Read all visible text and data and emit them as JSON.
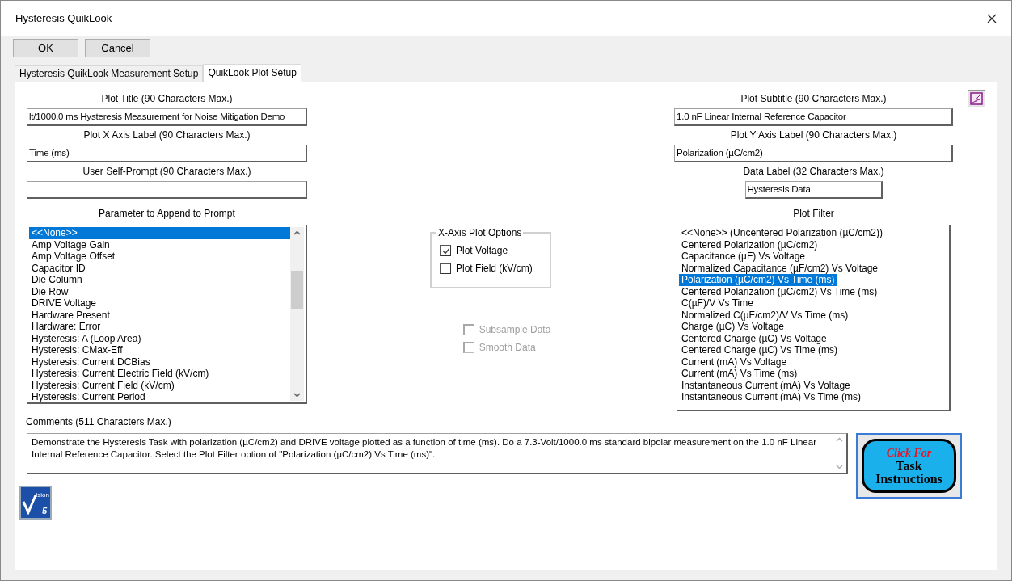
{
  "window": {
    "title": "Hysteresis QuikLook"
  },
  "buttons": [
    "OK",
    "Cancel"
  ],
  "tabs": [
    {
      "label": "Hysteresis QuikLook Measurement Setup",
      "selected": false
    },
    {
      "label": "QuikLook Plot Setup",
      "selected": true
    }
  ],
  "left_fields": [
    {
      "label": "Plot Title (90 Characters Max.)",
      "value": "lt/1000.0 ms Hysteresis Measurement for Noise Mitigation Demo"
    },
    {
      "label": "Plot X Axis Label (90 Characters Max.)",
      "value": "Time (ms)"
    },
    {
      "label": "User Self-Prompt (90 Characters Max.)"
    }
  ],
  "right_fields": [
    {
      "label": "Plot Subtitle (90 Characters Max.)",
      "value": "1.0 nF Linear Internal Reference Capacitor"
    },
    {
      "label": "Plot Y Axis Label (90 Characters Max.)",
      "value": "Polarization (µC/cm2)"
    },
    {
      "label": "Data Label (32 Characters Max.)",
      "value": "Hysteresis Data",
      "kind": "short"
    }
  ],
  "parameter_list": {
    "label": "Parameter to Append to Prompt",
    "items": [
      {
        "text": "<<None>>",
        "selected": true
      },
      {
        "text": "Amp Voltage Gain",
        "selected": false
      },
      {
        "text": "Amp Voltage Offset",
        "selected": false
      },
      {
        "text": "Capacitor ID",
        "selected": false
      },
      {
        "text": "Die Column",
        "selected": false
      },
      {
        "text": "Die Row",
        "selected": false
      },
      {
        "text": "DRIVE Voltage",
        "selected": false
      },
      {
        "text": "Hardware Present",
        "selected": false
      },
      {
        "text": "Hardware: Error",
        "selected": false
      },
      {
        "text": "Hysteresis: A (Loop Area)",
        "selected": false
      },
      {
        "text": "Hysteresis: CMax-Eff",
        "selected": false
      },
      {
        "text": "Hysteresis: Current DCBias",
        "selected": false
      },
      {
        "text": "Hysteresis: Current Electric Field (kV/cm)",
        "selected": false
      },
      {
        "text": "Hysteresis: Current Field (kV/cm)",
        "selected": false
      },
      {
        "text": "Hysteresis: Current Period",
        "selected": false
      }
    ]
  },
  "x_axis_options": {
    "title": "X-Axis Plot Options",
    "options": [
      {
        "label": "Plot Voltage",
        "checked": true
      },
      {
        "label": "Plot Field (kV/cm)",
        "checked": false
      }
    ]
  },
  "data_options": [
    {
      "label": "Subsample Data",
      "checked": false,
      "disabled": true
    },
    {
      "label": "Smooth Data",
      "checked": false,
      "disabled": true
    }
  ],
  "plot_filter": {
    "label": "Plot Filter",
    "items": [
      {
        "text": "<<None>> (Uncentered Polarization (µC/cm2))",
        "selected": false
      },
      {
        "text": "Centered Polarization (µC/cm2)",
        "selected": false
      },
      {
        "text": "Capacitance (µF) Vs Voltage",
        "selected": false
      },
      {
        "text": "Normalized Capacitance (µF/cm2) Vs Voltage",
        "selected": false
      },
      {
        "text": "Polarization (µC/cm2) Vs Time (ms)",
        "selected": true
      },
      {
        "text": "Centered Polarization (µC/cm2) Vs Time (ms)",
        "selected": false
      },
      {
        "text": "C(µF)/V Vs Time",
        "selected": false
      },
      {
        "text": "Normalized C(µF/cm2)/V Vs Time (ms)",
        "selected": false
      },
      {
        "text": "Charge (µC) Vs Voltage",
        "selected": false
      },
      {
        "text": "Centered Charge (µC) Vs Voltage",
        "selected": false
      },
      {
        "text": "Centered Charge (µC) Vs Time (ms)",
        "selected": false
      },
      {
        "text": "Current (mA) Vs Voltage",
        "selected": false
      },
      {
        "text": "Current (mA) Vs Time (ms)",
        "selected": false
      },
      {
        "text": "Instantaneous Current (mA) Vs Voltage",
        "selected": false
      },
      {
        "text": "Instantaneous Current (mA) Vs Time (ms)",
        "selected": false
      }
    ]
  },
  "comments": {
    "label": "Comments (511 Characters Max.)",
    "value": "Demonstrate the Hysteresis Task with polarization (µC/cm2) and DRIVE voltage plotted as a function of time (ms). Do a 7.3-Volt/1000.0 ms standard bipolar measurement on the 1.0 nF Linear Internal Reference Capacitor. Select the Plot Filter option of \"Polarization (µC/cm2) Vs Time (ms)\"."
  },
  "task_button": {
    "top": "Click For",
    "middle": "Task",
    "bottom": "Instructions"
  },
  "logo": {
    "small": "ision",
    "digit": "5"
  }
}
